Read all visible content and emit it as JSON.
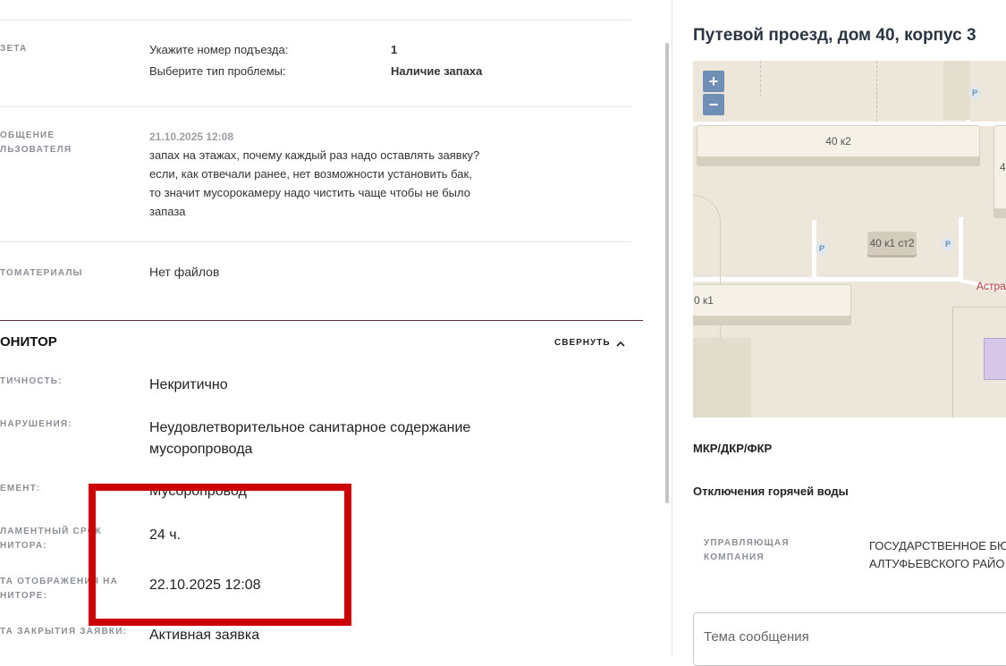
{
  "details": {
    "questionnaire": {
      "label": "ЗЕТА",
      "rows": [
        {
          "q": "Укажите номер подъезда:",
          "a": "1"
        },
        {
          "q": "Выберите тип проблемы:",
          "a": "Наличие запаха"
        }
      ]
    },
    "message": {
      "label_line1": "ОБЩЕНИЕ",
      "label_line2": "ЛЬЗОВАТЕЛЯ",
      "timestamp": "21.10.2025 12:08",
      "lines": [
        "запах на этажах, почему каждый раз надо оставлять заявку?",
        "если, как отвечали ранее, нет возможности установить бак,",
        "то значит мусорокамеру надо чистить чаще чтобы не было",
        "запаза"
      ]
    },
    "photos": {
      "label": "ТОМАТЕРИАЛЫ",
      "value": "Нет файлов"
    }
  },
  "monitor": {
    "title": "ОНИТОР",
    "collapse_label": "СВЕРНУТЬ",
    "fields": [
      {
        "label1": "ТИЧНОСТЬ:",
        "label2": "",
        "value1": "Некритично",
        "value2": ""
      },
      {
        "label1": "НАРУШЕНИЯ:",
        "label2": "",
        "value1": "Неудовлетворительное санитарное содержание",
        "value2": "мусоропровода"
      },
      {
        "label1": "ЕМЕНТ:",
        "label2": "",
        "value1": "Мусоропровод",
        "value2": ""
      },
      {
        "label1": "ЛАМЕНТНЫЙ СРОК",
        "label2": "НИТОРА:",
        "value1": "24 ч.",
        "value2": ""
      },
      {
        "label1": "ТА ОТОБРАЖЕНИЯ НА",
        "label2": "НИТОРЕ:",
        "value1": "22.10.2025 12:08",
        "value2": ""
      },
      {
        "label1": "ТА ЗАКРЫТИЯ ЗАЯВКИ:",
        "label2": "",
        "value1": "Активная заявка",
        "value2": ""
      }
    ]
  },
  "right_panel": {
    "address": "Путевой проезд, дом 40, корпус 3",
    "map": {
      "zoom_in": "+",
      "zoom_out": "−",
      "buildings": [
        "40 к2",
        "40 к1 ст2",
        "0 к1",
        "4"
      ],
      "street": "Астра",
      "parking_symbol": "P"
    },
    "program": "МКР/ДКР/ФКР",
    "hot_water": "Отключения горячей воды",
    "management": {
      "label_line1": "УПРАВЛЯЮЩАЯ",
      "label_line2": "КОМПАНИЯ",
      "value_line1": "ГОСУДАРСТВЕННОЕ БЮ",
      "value_line2": "АЛТУФЬЕВСКОГО РАЙО"
    },
    "subject_placeholder": "Тема сообщения"
  },
  "colors": {
    "highlight": "#cc0000",
    "accent_divider": "#5a2a3a",
    "map_button": "#6f8fb7"
  }
}
